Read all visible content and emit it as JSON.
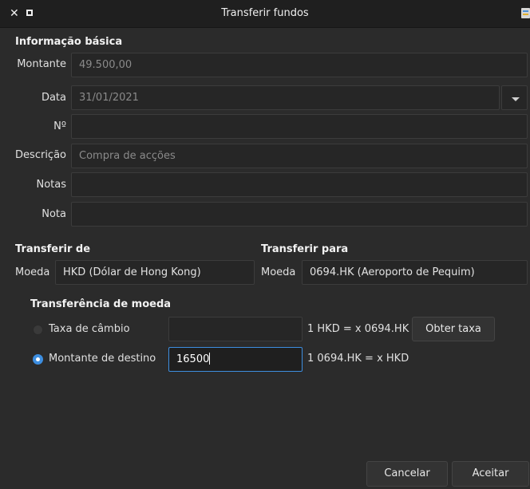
{
  "window": {
    "title": "Transferir fundos"
  },
  "basic": {
    "section_title": "Informação básica",
    "amount_label": "Montante",
    "amount_value": "49.500,00",
    "date_label": "Data",
    "date_value": "31/01/2021",
    "number_label": "Nº",
    "number_value": "",
    "description_label": "Descrição",
    "description_value": "Compra de acções",
    "notes_label": "Notas",
    "notes_value": "",
    "memo_label": "Nota",
    "memo_value": ""
  },
  "transfer_from": {
    "section_title": "Transferir de",
    "currency_label": "Moeda",
    "currency_value": "HKD (Dólar de Hong Kong)"
  },
  "transfer_to": {
    "section_title": "Transferir para",
    "currency_label": "Moeda",
    "currency_value": "0694.HK (Aeroporto de Pequim)"
  },
  "currency_transfer": {
    "section_title": "Transferência de moeda",
    "exchange_rate_label": "Taxa de câmbio",
    "exchange_rate_value": "",
    "exchange_rate_selected": false,
    "exchange_rate_formula": "1 HKD = x 0694.HK",
    "get_rate_label": "Obter taxa",
    "to_amount_label": "Montante de destino",
    "to_amount_value": "16500",
    "to_amount_selected": true,
    "to_amount_formula": "1 0694.HK = x HKD"
  },
  "buttons": {
    "cancel_label": "Cancelar",
    "ok_label": "Aceitar"
  },
  "colors": {
    "accent": "#3d8ee0",
    "background": "#2b2b2b",
    "titlebar": "#1f1f1f"
  }
}
